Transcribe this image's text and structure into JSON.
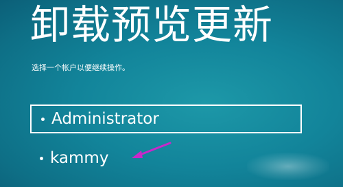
{
  "screen": {
    "title": "卸载预览更新",
    "subtitle": "选择一个帐户以便继续操作。"
  },
  "accounts": [
    {
      "name": "Administrator",
      "selected": true
    },
    {
      "name": "kammy",
      "selected": false
    }
  ],
  "annotation": {
    "icon": "arrow-pointer-icon",
    "color": "#c928c9"
  },
  "colors": {
    "background": "#12849a",
    "text": "#ffffff"
  }
}
